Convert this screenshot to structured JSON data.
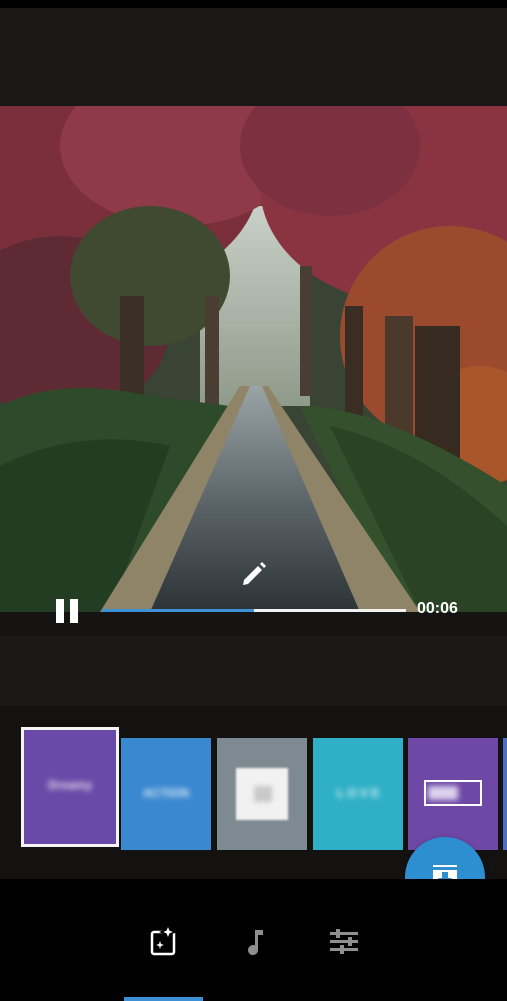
{
  "player": {
    "current_time": "00:06",
    "progress_fraction": 0.5
  },
  "themes": [
    {
      "name": "Dreamy",
      "color": "#6a4aa8",
      "selected": true
    },
    {
      "name": "ACTION",
      "color": "#3a88d0",
      "selected": false
    },
    {
      "name": "",
      "color": "#7e8a92",
      "selected": false
    },
    {
      "name": "L O V E",
      "color": "#2fb0c6",
      "selected": false
    },
    {
      "name": "",
      "color": "#6f48a6",
      "selected": false
    }
  ],
  "nav": {
    "tabs": [
      "auto-edit-icon",
      "music-icon",
      "adjustments-icon"
    ],
    "active_index": 0
  },
  "colors": {
    "accent": "#3d8fd6",
    "fab": "#2e8fd0"
  }
}
